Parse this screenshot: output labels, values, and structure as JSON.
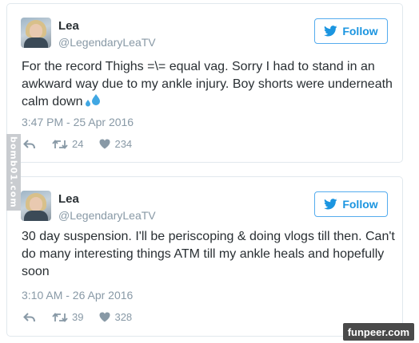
{
  "tweets": [
    {
      "name": "Lea",
      "handle": "@LegendaryLeaTV",
      "follow_label": "Follow",
      "text": "For the record Thighs =\\= equal vag. Sorry I had to stand in an awkward way due to my ankle injury. Boy shorts were underneath calm down",
      "emoji_icon": "sweat-droplets-icon",
      "timestamp": "3:47 PM - 25 Apr 2016",
      "retweets": "24",
      "likes": "234"
    },
    {
      "name": "Lea",
      "handle": "@LegendaryLeaTV",
      "follow_label": "Follow",
      "text": "30 day suspension. I'll be periscoping & doing vlogs till then. Can't do many interesting things ATM till my ankle heals and hopefully soon",
      "timestamp": "3:10 AM - 26 Apr 2016",
      "retweets": "39",
      "likes": "328"
    }
  ],
  "side_watermark": "bomb01.com",
  "corner_watermark": "funpeer.com",
  "colors": {
    "twitter_blue": "#1b95e0",
    "muted": "#8899a6",
    "border": "#e1e8ed",
    "text": "#292f33"
  }
}
